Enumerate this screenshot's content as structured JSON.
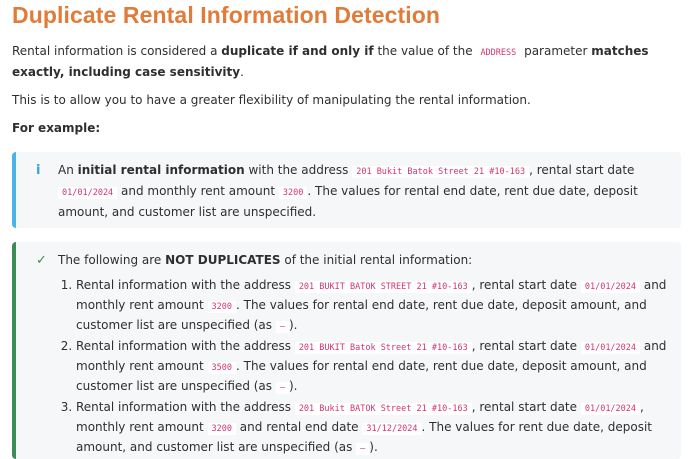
{
  "title": "Duplicate Rental Information Detection",
  "intro": {
    "t1": "Rental information is considered a ",
    "b1": "duplicate if and only if",
    "t2": " the value of the ",
    "code": "ADDRESS",
    "t3": " parameter ",
    "b2": "matches exactly, including case sensitivity",
    "t4": "."
  },
  "flex_note": "This is to allow you to have a greater flexibility of manipulating the rental information.",
  "for_example": "For example:",
  "info_box": {
    "icon": "i",
    "t1": "An ",
    "b1": "initial rental information",
    "t2": " with the address ",
    "address": "201 Bukit Batok Street 21 #10-163",
    "t3": ", rental start date ",
    "start_date": "01/01/2024",
    "t4": " and monthly rent amount ",
    "rent": "3200",
    "t5": ". The values for rental end date, rent due date, deposit amount, and customer list are unspecified."
  },
  "success_box": {
    "icon": "✓",
    "t1": "The following are ",
    "b1": "NOT DUPLICATES",
    "t2": " of the initial rental information:",
    "items": [
      {
        "a": "Rental information with the address ",
        "address": "201 BUKIT BATOK STREET 21 #10-163",
        "b": ", rental start date ",
        "start_date": "01/01/2024",
        "c": " and monthly rent amount ",
        "rent": "3200",
        "d": ". The values for rental end date, rent due date, deposit amount, and customer list are unspecified (as ",
        "dash": "–",
        "e": ")."
      },
      {
        "a": "Rental information with the address ",
        "address": "201 BUKIT Batok Street 21 #10-163",
        "b": ", rental start date ",
        "start_date": "01/01/2024",
        "c": " and monthly rent amount ",
        "rent": "3500",
        "d": ". The values for rental end date, rent due date, deposit amount, and customer list are unspecified (as ",
        "dash": "–",
        "e": ")."
      },
      {
        "a": "Rental information with the address ",
        "address": "201 Bukit BATOK Street 21 #10-163",
        "b": ", rental start date ",
        "start_date": "01/01/2024",
        "c": ", monthly rent amount ",
        "rent": "3200",
        "c2": " and rental end date ",
        "end_date": "31/12/2024",
        "d": ". The values for rent due date, deposit amount, and customer list are unspecified (as ",
        "dash": "–",
        "e": ")."
      }
    ]
  },
  "colors": {
    "title": "#e07b39",
    "code": "#d6336c",
    "info_border": "#4bb3e6",
    "success_border": "#3c8c56"
  }
}
